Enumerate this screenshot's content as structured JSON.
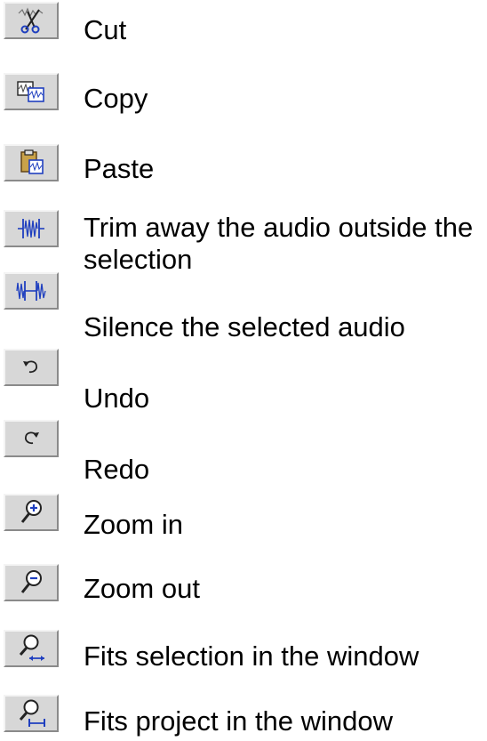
{
  "toolbar_legend": {
    "items": [
      {
        "label": "Cut",
        "icon": "scissors-icon"
      },
      {
        "label": "Copy",
        "icon": "copy-icon"
      },
      {
        "label": "Paste",
        "icon": "paste-icon"
      },
      {
        "label": "Trim away the audio outside the selection",
        "icon": "trim-icon"
      },
      {
        "label": "Silence the selected audio",
        "icon": "silence-icon"
      },
      {
        "label": "Undo",
        "icon": "undo-icon"
      },
      {
        "label": "Redo",
        "icon": "redo-icon"
      },
      {
        "label": "Zoom in",
        "icon": "zoom-in-icon"
      },
      {
        "label": "Zoom out",
        "icon": "zoom-out-icon"
      },
      {
        "label": "Fits selection in the window",
        "icon": "fit-selection-icon"
      },
      {
        "label": "Fits project in the window",
        "icon": "fit-project-icon"
      }
    ]
  },
  "colors": {
    "button_face": "#d7d7d7",
    "icon_blue": "#1f3fbf",
    "text": "#000000"
  }
}
